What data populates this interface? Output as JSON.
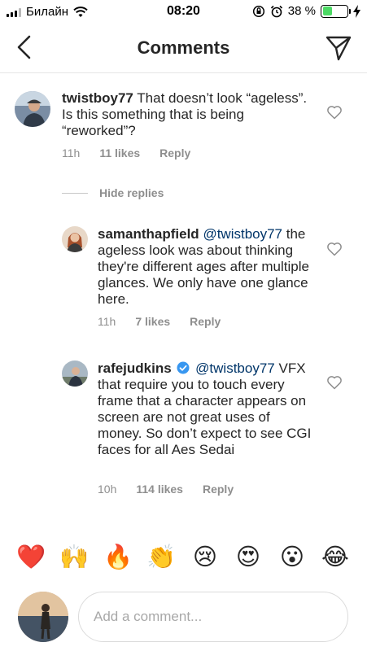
{
  "status_bar": {
    "carrier": "Билайн",
    "time": "08:20",
    "battery_percent_label": "38 %",
    "battery_level": 0.38,
    "battery_color": "#4cd964"
  },
  "nav": {
    "title": "Comments",
    "back_icon": "chevron-left-icon",
    "send_icon": "paper-plane-icon"
  },
  "comments": [
    {
      "username": "twistboy77",
      "text": " That doesn’t look “ageless”. Is this something that is being “reworked”?",
      "time": "11h",
      "likes": "11 likes",
      "reply": "Reply"
    },
    {
      "username": "samanthapfield",
      "mention": "@twistboy77",
      "text": "the ageless look was about thinking they're different ages after multiple glances. We only have one glance here.",
      "time": "11h",
      "likes": "7 likes",
      "reply": "Reply"
    },
    {
      "username": "rafejudkins",
      "verified": true,
      "mention": "@twistboy77",
      "text": "VFX that require you to touch every frame that a character appears on screen are not great uses of money.  So don’t expect to see CGI faces for all Aes Sedai",
      "time": "10h",
      "likes": "114 likes",
      "reply": "Reply"
    }
  ],
  "hide_replies": "Hide replies",
  "emoji_bar": [
    "❤️",
    "🙌",
    "🔥",
    "👏",
    "😢",
    "😍",
    "😮",
    "😂"
  ],
  "composer": {
    "placeholder": "Add a comment..."
  },
  "colors": {
    "accent_link": "#003569",
    "muted": "#8e8e8e",
    "verified_blue": "#3897f0"
  }
}
